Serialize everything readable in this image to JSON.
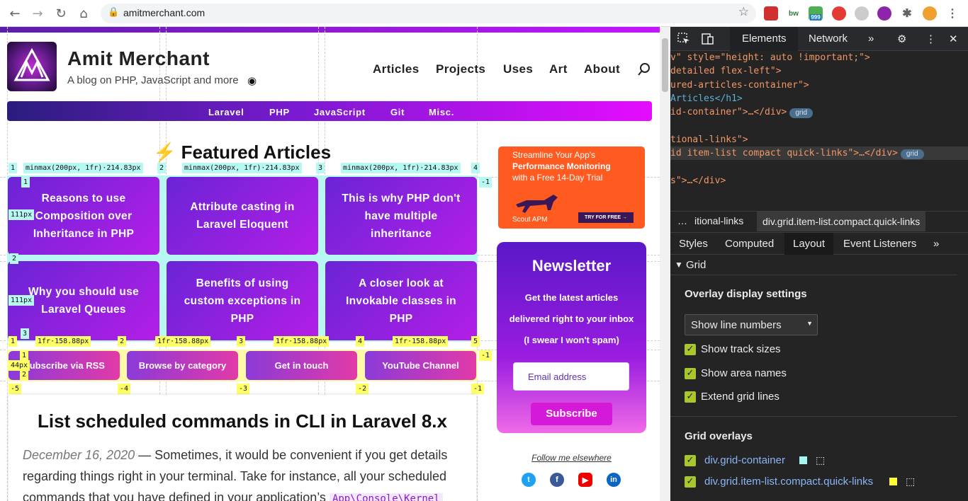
{
  "browser": {
    "url": "amitmerchant.com",
    "back_icon": "←",
    "forward_icon": "→",
    "reload_icon": "↻",
    "home_icon": "⌂",
    "lock_icon": "🔒",
    "star_icon": "☆",
    "ext_badge": "999"
  },
  "site": {
    "title": "Amit Merchant",
    "tagline": "A blog on PHP, JavaScript and more",
    "rss_icon": "◉",
    "nav": [
      "Articles",
      "Projects",
      "Uses",
      "Art",
      "About"
    ],
    "categories": [
      "Laravel",
      "PHP",
      "JavaScript",
      "Git",
      "Misc."
    ]
  },
  "featured": {
    "emoji": "⚡",
    "title": "Featured Articles",
    "cards": [
      "Reasons to use Composition over Inheritance in PHP",
      "Attribute casting in Laravel Eloquent",
      "This is why PHP don't have multiple inheritance",
      "Why you should use Laravel Queues",
      "Benefits of using custom exceptions in PHP",
      "A closer look at Invokable classes in PHP"
    ],
    "col_track": "minmax(200px, 1fr)·214.83px",
    "row_track": "111px",
    "line_numbers_top": [
      "1",
      "2",
      "3",
      "4"
    ],
    "line_neg": "-1",
    "row_numbers": [
      "1",
      "2",
      "3"
    ]
  },
  "quick_links": {
    "items": [
      "Subscribe via RSS",
      "Browse by category",
      "Get in touch",
      "YouTube Channel"
    ],
    "track": "1fr·158.88px",
    "row_track": "44px",
    "top_numbers": [
      "1",
      "2",
      "3",
      "4",
      "5"
    ],
    "bottom_numbers": [
      "-5",
      "-4",
      "-3",
      "-2",
      "-1"
    ],
    "misc_numbers": [
      "-4",
      "-3",
      "-2",
      "-1",
      "1",
      "2"
    ]
  },
  "post": {
    "title": "List scheduled commands in CLI in Laravel 8.x",
    "date": "December 16, 2020",
    "body1": " — Sometimes, it would be convenient if you get details regarding things right in your terminal. Take for instance, all your scheduled commands that you have defined in your application’s ",
    "code": "App\\Console\\Kernel"
  },
  "ad": {
    "line1": "Streamline Your App's",
    "line2": "Performance Monitoring",
    "line3": "with a Free 14-Day Trial",
    "button": "TRY FOR FREE →",
    "brand": "Scout APM"
  },
  "newsletter": {
    "title": "Newsletter",
    "description": "Get the latest articles delivered right to your inbox (I swear I won't spam)",
    "email_placeholder": "Email address",
    "subscribe": "Subscribe"
  },
  "follow": {
    "label": "Follow me elsewhere"
  },
  "devtools": {
    "tabs": [
      "Elements",
      "Network"
    ],
    "more_tabs_icon": "»",
    "dom_lines": [
      {
        "attr": "v\" style=\"height: auto !important;\">",
        "badge": ""
      },
      {
        "attr": "detailed flex-left\">",
        "badge": ""
      },
      {
        "attr": "ured-articles-container\">",
        "badge": ""
      },
      {
        "attr": "",
        "text": " Articles</h1>",
        "badge": ""
      },
      {
        "attr": "id-container\">…</div>",
        "badge": "grid"
      },
      {
        "attr": "",
        "badge": ""
      },
      {
        "attr": "tional-links\">",
        "badge": ""
      },
      {
        "attr": "id item-list compact quick-links\">…</div>",
        "badge": "grid"
      },
      {
        "attr": "",
        "badge": ""
      },
      {
        "attr": "s\">…</div>",
        "badge": ""
      }
    ],
    "breadcrumbs": [
      "…",
      "itional-links",
      "div.grid.item-list.compact.quick-links"
    ],
    "panel_tabs": [
      "Styles",
      "Computed",
      "Layout",
      "Event Listeners"
    ],
    "grid_section": {
      "header": "Grid",
      "overlay_settings": "Overlay display settings",
      "select_value": "Show line numbers",
      "checkboxes": [
        "Show track sizes",
        "Show area names",
        "Extend grid lines"
      ],
      "overlays_header": "Grid overlays",
      "overlays": [
        "div.grid-container",
        "div.grid.item-list.compact.quick-links"
      ],
      "overlay_colors": [
        "#a8f5f0",
        "#ffff33"
      ]
    }
  }
}
